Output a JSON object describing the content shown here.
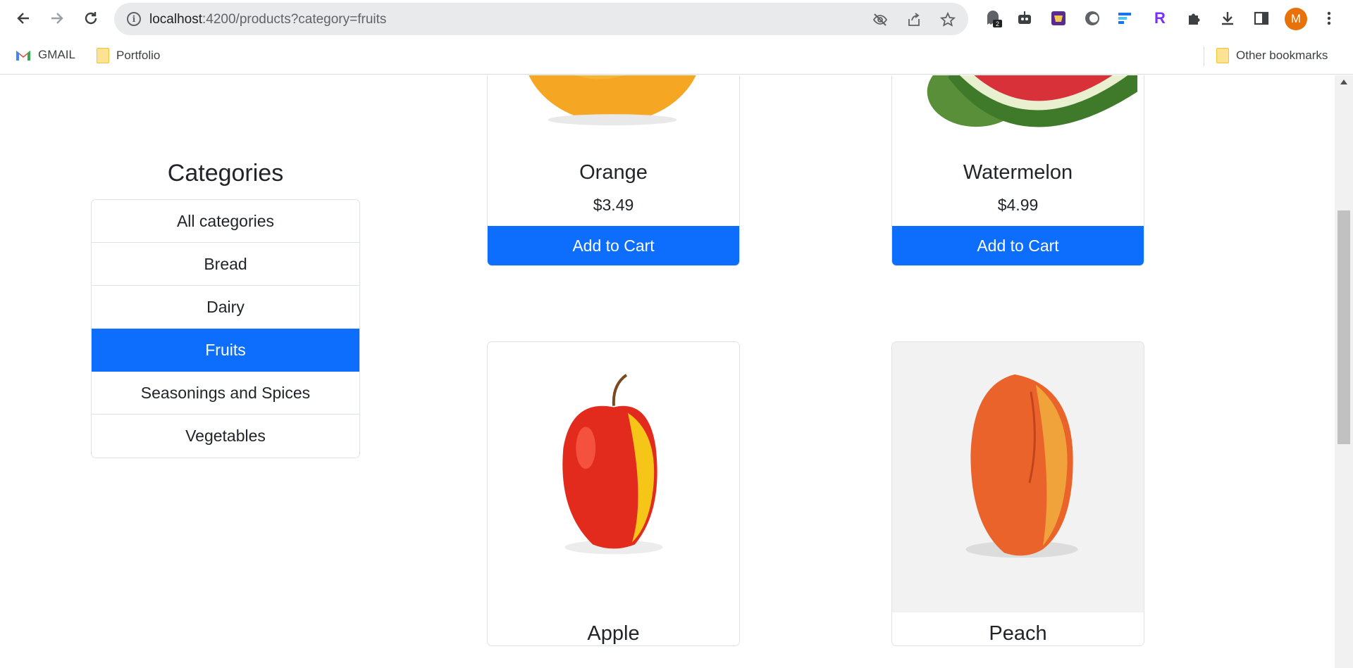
{
  "browser": {
    "url_host": "localhost",
    "url_path": ":4200/products?category=fruits",
    "extension_badge": "2",
    "avatar_letter": "M",
    "bookmarks": [
      {
        "label": "GMAIL",
        "icon": "gmail-icon"
      },
      {
        "label": "Portfolio",
        "icon": "folder-icon"
      }
    ],
    "other_bookmarks": "Other bookmarks"
  },
  "categories": {
    "title": "Categories",
    "items": [
      {
        "label": "All categories",
        "active": false
      },
      {
        "label": "Bread",
        "active": false
      },
      {
        "label": "Dairy",
        "active": false
      },
      {
        "label": "Fruits",
        "active": true
      },
      {
        "label": "Seasonings and Spices",
        "active": false
      },
      {
        "label": "Vegetables",
        "active": false
      }
    ]
  },
  "products": [
    {
      "name": "Orange",
      "price": "$3.49",
      "button": "Add to Cart"
    },
    {
      "name": "Watermelon",
      "price": "$4.99",
      "button": "Add to Cart"
    },
    {
      "name": "Apple"
    },
    {
      "name": "Peach"
    }
  ],
  "colors": {
    "primary": "#0d6efd"
  }
}
